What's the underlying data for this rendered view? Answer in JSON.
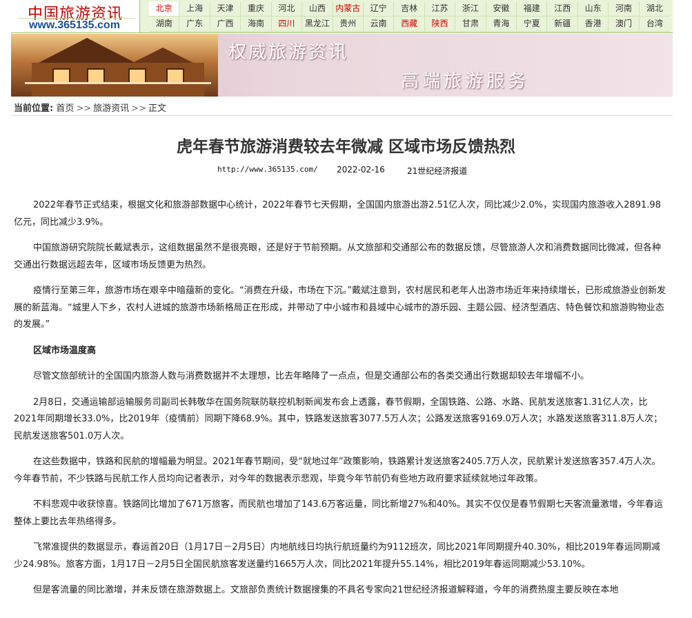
{
  "logo": {
    "name": "中国旅游资讯",
    "url": "www.365135.com"
  },
  "nav": {
    "row1": [
      {
        "label": "北京",
        "red": true,
        "hl": true
      },
      {
        "label": "上海"
      },
      {
        "label": "天津"
      },
      {
        "label": "重庆"
      },
      {
        "label": "河北"
      },
      {
        "label": "山西"
      },
      {
        "label": "内蒙古",
        "red": true
      },
      {
        "label": "辽宁"
      },
      {
        "label": "吉林"
      },
      {
        "label": "江苏"
      },
      {
        "label": "浙江"
      },
      {
        "label": "安徽"
      },
      {
        "label": "福建"
      },
      {
        "label": "江西"
      },
      {
        "label": "山东"
      },
      {
        "label": "河南"
      },
      {
        "label": "湖北"
      }
    ],
    "row2": [
      {
        "label": "湖南"
      },
      {
        "label": "广东"
      },
      {
        "label": "广西"
      },
      {
        "label": "海南"
      },
      {
        "label": "四川",
        "red": true
      },
      {
        "label": "黑龙江"
      },
      {
        "label": "贵州"
      },
      {
        "label": "云南"
      },
      {
        "label": "西藏",
        "red": true
      },
      {
        "label": "陕西",
        "red": true
      },
      {
        "label": "甘肃"
      },
      {
        "label": "青海"
      },
      {
        "label": "宁夏"
      },
      {
        "label": "新疆"
      },
      {
        "label": "香港"
      },
      {
        "label": "澳门"
      },
      {
        "label": "台湾"
      }
    ]
  },
  "banner": {
    "tagline1": "权威旅游资讯",
    "tagline2": "高端旅游服务"
  },
  "breadcrumb": {
    "label": "当前位置:",
    "home": "首页",
    "sep": ">>",
    "section": "旅游资讯",
    "current": "正文"
  },
  "article": {
    "title": "虎年春节旅游消费较去年微减 区域市场反馈热烈",
    "source_url": "http://www.365135.com/",
    "date": "2022-02-16",
    "source": "21世纪经济报道",
    "paragraphs": [
      {
        "text": "2022年春节正式结束，根据文化和旅游部数据中心统计，2022年春节七天假期，全国国内旅游出游2.51亿人次，同比减少2.0%，实现国内旅游收入2891.98亿元，同比减少3.9%。"
      },
      {
        "text": "中国旅游研究院院长戴斌表示，这组数据虽然不是很亮眼，还是好于节前预期。从文旅部和交通部公布的数据反馈，尽管旅游人次和消费数据同比微减，但各种交通出行数据远超去年，区域市场反馈更为热烈。"
      },
      {
        "text": "疫情行至第三年，旅游市场在艰辛中暗蕴新的变化。“消费在升级，市场在下沉。”戴斌注意到，农村居民和老年人出游市场近年来持续增长，已形成旅游业创新发展的新蓝海。“城里人下乡，农村人进城的旅游市场新格局正在形成，并带动了中小城市和县域中心城市的游乐园、主题公园、经济型酒店、特色餐饮和旅游购物业态的发展。”"
      },
      {
        "text": "区域市场温度高",
        "head": true
      },
      {
        "text": "尽管文旅部统计的全国国内旅游人数与消费数据并不太理想，比去年略降了一点点，但是交通部公布的各类交通出行数据却较去年增幅不小。"
      },
      {
        "text": "2月8日，交通运输部运输服务司副司长韩敬华在国务院联防联控机制新闻发布会上透露，春节假期，全国铁路、公路、水路、民航发送旅客1.31亿人次，比2021年同期增长33.0%，比2019年（疫情前）同期下降68.9%。其中，铁路发送旅客3077.5万人次；公路发送旅客9169.0万人次；水路发送旅客311.8万人次；民航发送旅客501.0万人次。"
      },
      {
        "text": "在这些数据中，铁路和民航的增幅最为明显。2021年春节期间，受“就地过年”政策影响，铁路累计发送旅客2405.7万人次，民航累计发送旅客357.4万人次。今年春节前，不少铁路与民航工作人员均向记者表示，对今年的数据表示悲观，毕竟今年节前仍有些地方政府要求延续就地过年政策。"
      },
      {
        "text": "不料悲观中收获惊喜。铁路同比增加了671万旅客，而民航也增加了143.6万客运量，同比新增27%和40%。其实不仅仅是春节假期七天客流量激增，今年春运整体上要比去年热络得多。"
      },
      {
        "text": "飞常准提供的数据显示，春运首20日（1月17日－2月5日）内地航线日均执行航班量约为9112班次，同比2021年同期提升40.30%，相比2019年春运同期减少24.98%。旅客方面，1月17日－2月5日全国民航旅客发送量约1665万人次，同比2021年提升55.14%，相比2019年春运同期减少53.10%。"
      },
      {
        "text": "但是客流量的同比激增，并未反馈在旅游数据上。文旅部负责统计数据搜集的不具名专家向21世纪经济报道解释道，今年的消费热度主要反映在本地"
      }
    ]
  }
}
